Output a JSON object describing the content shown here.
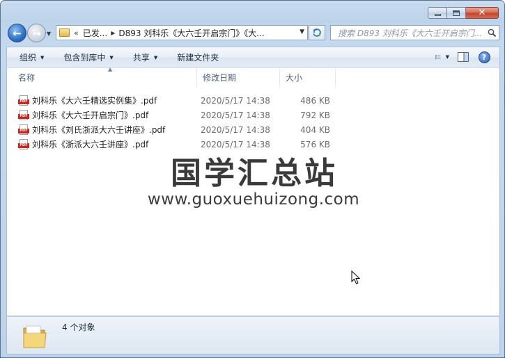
{
  "address": {
    "chevron": "«",
    "segments": [
      "已发...",
      "D893 刘科乐《大六壬开启宗门》《大..."
    ]
  },
  "search": {
    "placeholder": "搜索 D893 刘科乐《大六壬开启宗门..."
  },
  "toolbar": {
    "organize": "组织",
    "include_in_library": "包含到库中",
    "share": "共享",
    "new_folder": "新建文件夹"
  },
  "columns": {
    "name": "名称",
    "date": "修改日期",
    "size": "大小"
  },
  "files": [
    {
      "name": "刘科乐《大六壬精选实例集》.pdf",
      "date": "2020/5/17 14:38",
      "size": "486 KB",
      "icon": "pdf-icon"
    },
    {
      "name": "刘科乐《大六壬开启宗门》.pdf",
      "date": "2020/5/17 14:38",
      "size": "792 KB",
      "icon": "pdf-icon"
    },
    {
      "name": "刘科乐《刘氏浙派大六壬讲座》.pdf",
      "date": "2020/5/17 14:38",
      "size": "404 KB",
      "icon": "pdf-icon"
    },
    {
      "name": "刘科乐《浙派大六壬讲座》.pdf",
      "date": "2020/5/17 14:38",
      "size": "576 KB",
      "icon": "pdf-icon"
    }
  ],
  "watermark": {
    "title": "国学汇总站",
    "url": "www.guoxuehuizong.com"
  },
  "details": {
    "count": "4 个对象"
  },
  "icons": {
    "pdf_tag": "PDF",
    "back": "back-arrow-icon",
    "forward": "forward-arrow-icon",
    "refresh": "refresh-icon",
    "search": "search-icon",
    "views": "view-options-icon",
    "preview": "preview-pane-icon",
    "help": "help-icon",
    "folder": "folder-icon"
  }
}
